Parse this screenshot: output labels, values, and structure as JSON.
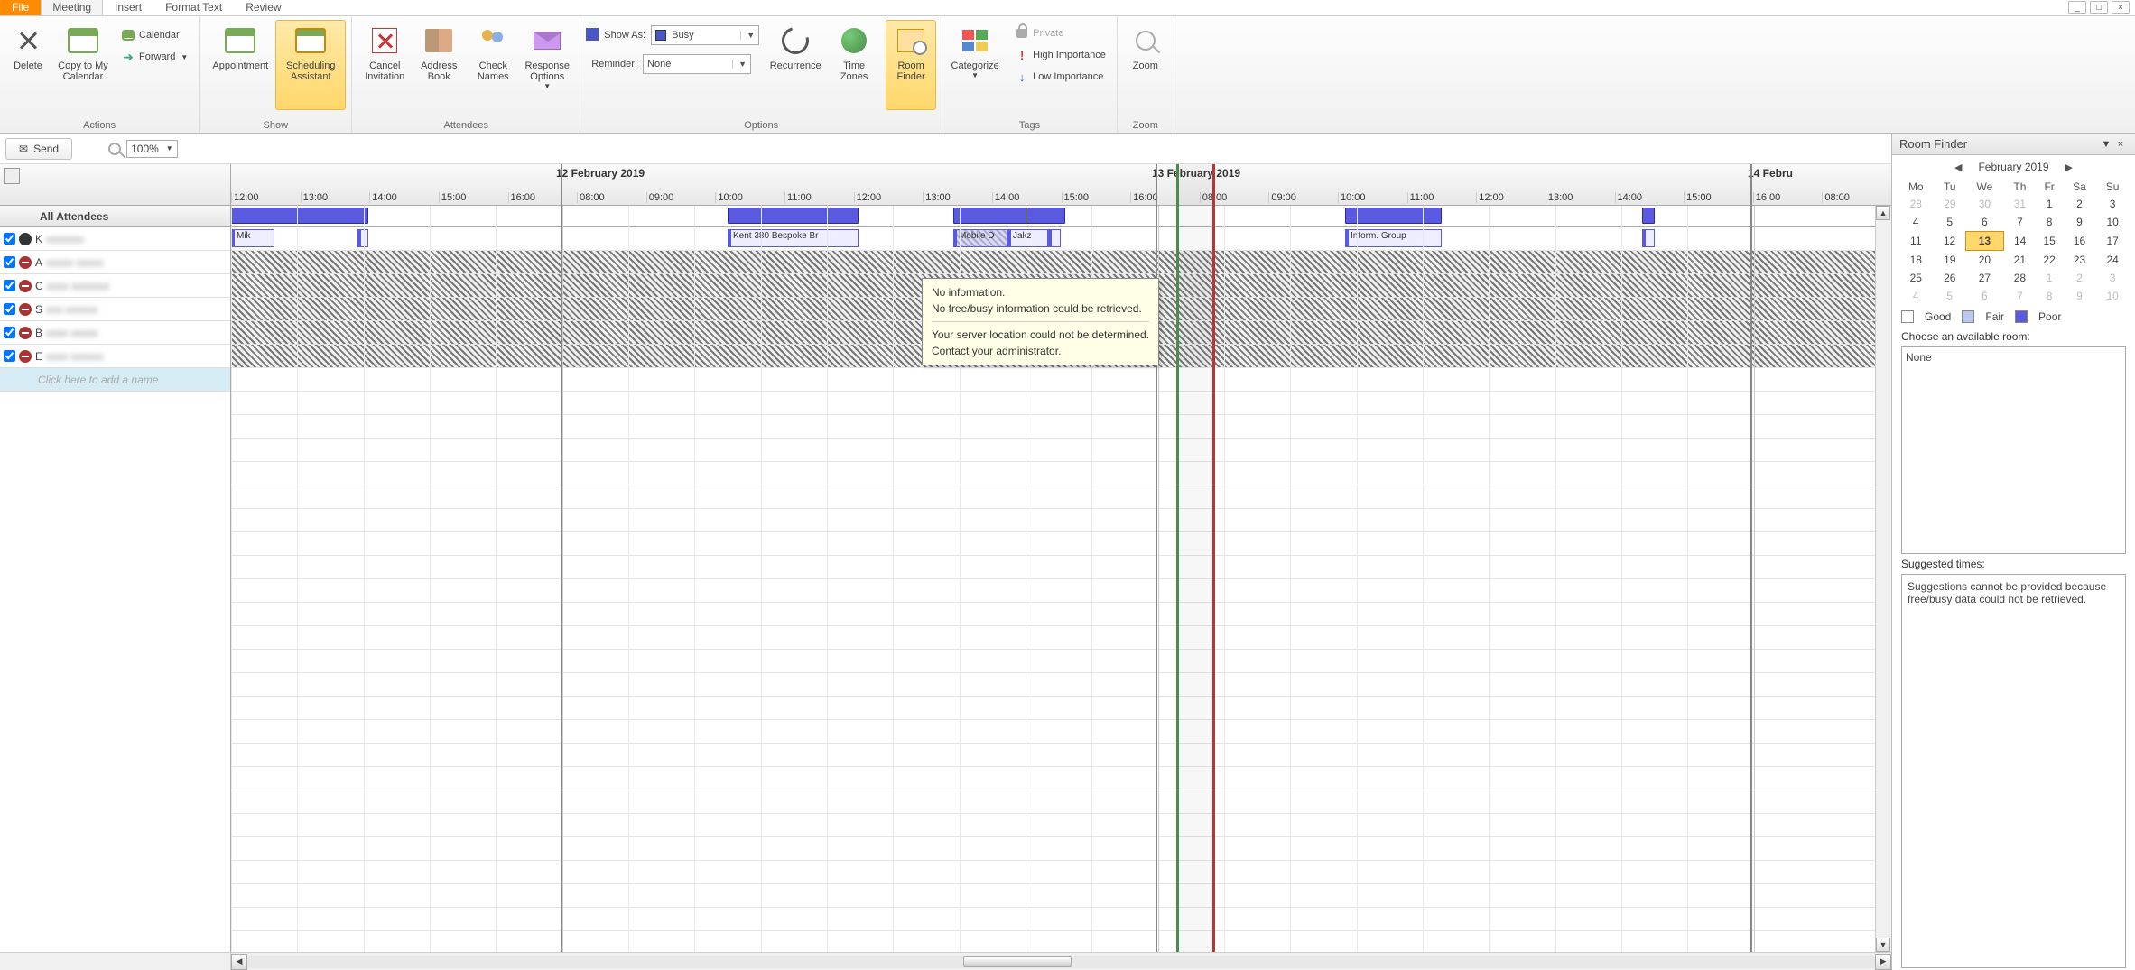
{
  "window": {
    "minimize": "_",
    "maximize": "□",
    "close": "×"
  },
  "tabs": {
    "file": "File",
    "meeting": "Meeting",
    "insert": "Insert",
    "format_text": "Format Text",
    "review": "Review"
  },
  "ribbon": {
    "actions": {
      "label": "Actions",
      "delete": "Delete",
      "copy_to_cal": "Copy to My\nCalendar",
      "calendar": "Calendar",
      "forward": "Forward"
    },
    "show": {
      "label": "Show",
      "appointment": "Appointment",
      "scheduling": "Scheduling\nAssistant"
    },
    "attendees": {
      "label": "Attendees",
      "cancel_inv": "Cancel\nInvitation",
      "address_book": "Address\nBook",
      "check_names": "Check\nNames",
      "response_opts": "Response\nOptions"
    },
    "options": {
      "label": "Options",
      "show_as_lbl": "Show As:",
      "show_as_val": "Busy",
      "reminder_lbl": "Reminder:",
      "reminder_val": "None",
      "recurrence": "Recurrence",
      "time_zones": "Time\nZones",
      "room_finder": "Room\nFinder"
    },
    "tags": {
      "label": "Tags",
      "categorize": "Categorize",
      "private": "Private",
      "high_importance": "High Importance",
      "low_importance": "Low Importance"
    },
    "zoom": {
      "label": "Zoom",
      "zoom": "Zoom"
    }
  },
  "send_bar": {
    "send": "Send",
    "zoom_val": "100%"
  },
  "timeline": {
    "date1": "12 February 2019",
    "date2": "13 February 2019",
    "date3": "14 Febru",
    "hours": [
      "12:00",
      "13:00",
      "14:00",
      "15:00",
      "16:00",
      "08:00",
      "09:00",
      "10:00",
      "11:00",
      "12:00",
      "13:00",
      "14:00",
      "15:00",
      "16:00",
      "08:00",
      "09:00",
      "10:00",
      "11:00",
      "12:00",
      "13:00",
      "14:00",
      "15:00",
      "16:00",
      "08:00"
    ]
  },
  "attendees": {
    "header": "All Attendees",
    "add_placeholder": "Click here to add a name",
    "rows": [
      {
        "name": "K"
      },
      {
        "name": "A"
      },
      {
        "name": "C"
      },
      {
        "name": "S"
      },
      {
        "name": "B"
      },
      {
        "name": "E"
      }
    ]
  },
  "appts": {
    "mik": "Mik",
    "kent": "Kent 380 Bespoke Br",
    "mobile": "Mobile D",
    "jak": "Jakz",
    "info": "Inform. Group"
  },
  "tooltip": {
    "l1": "No information.",
    "l2": "No free/busy information could be retrieved.",
    "l3": "Your server location could not be determined.",
    "l4": "Contact your administrator."
  },
  "room_finder": {
    "title": "Room Finder",
    "month": "February 2019",
    "dow": [
      "Mo",
      "Tu",
      "We",
      "Th",
      "Fr",
      "Sa",
      "Su"
    ],
    "weeks": [
      [
        {
          "d": "28",
          "o": true
        },
        {
          "d": "29",
          "o": true
        },
        {
          "d": "30",
          "o": true
        },
        {
          "d": "31",
          "o": true
        },
        {
          "d": "1"
        },
        {
          "d": "2"
        },
        {
          "d": "3"
        }
      ],
      [
        {
          "d": "4"
        },
        {
          "d": "5"
        },
        {
          "d": "6"
        },
        {
          "d": "7"
        },
        {
          "d": "8"
        },
        {
          "d": "9"
        },
        {
          "d": "10"
        }
      ],
      [
        {
          "d": "11"
        },
        {
          "d": "12"
        },
        {
          "d": "13",
          "t": true
        },
        {
          "d": "14"
        },
        {
          "d": "15"
        },
        {
          "d": "16"
        },
        {
          "d": "17"
        }
      ],
      [
        {
          "d": "18"
        },
        {
          "d": "19"
        },
        {
          "d": "20"
        },
        {
          "d": "21"
        },
        {
          "d": "22"
        },
        {
          "d": "23"
        },
        {
          "d": "24"
        }
      ],
      [
        {
          "d": "25"
        },
        {
          "d": "26"
        },
        {
          "d": "27"
        },
        {
          "d": "28"
        },
        {
          "d": "1",
          "o": true
        },
        {
          "d": "2",
          "o": true
        },
        {
          "d": "3",
          "o": true
        }
      ],
      [
        {
          "d": "4",
          "o": true
        },
        {
          "d": "5",
          "o": true
        },
        {
          "d": "6",
          "o": true
        },
        {
          "d": "7",
          "o": true
        },
        {
          "d": "8",
          "o": true
        },
        {
          "d": "9",
          "o": true
        },
        {
          "d": "10",
          "o": true
        }
      ]
    ],
    "legend": {
      "good": "Good",
      "fair": "Fair",
      "poor": "Poor"
    },
    "choose_lbl": "Choose an available room:",
    "none": "None",
    "suggested_lbl": "Suggested times:",
    "suggested_msg": "Suggestions cannot be provided because free/busy data could not be retrieved."
  }
}
